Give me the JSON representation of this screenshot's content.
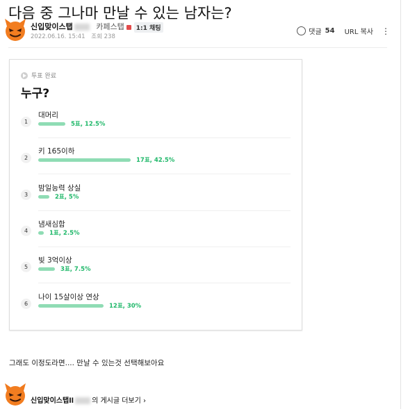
{
  "post": {
    "title": "다음 중 그나마 만날 수 있는 남자는?",
    "author": {
      "nickname": "신입맞이스탭",
      "role": "카페스탭",
      "chat_label": "1:1 채팅"
    },
    "date": "2022.06.16. 15:41",
    "views": "조회 238",
    "comments_label": "댓글",
    "comments_count": "54",
    "url_copy_label": "URL 복사",
    "more_label": "⋮",
    "body_text": "그래도 이정도라면.... 만날 수 있는것 선택해보아요",
    "footer": {
      "nickname": "신입맞이스탭ll",
      "suffix": "의 게시글 더보기 ›"
    }
  },
  "poll": {
    "status": "투표 완료",
    "question": "누구?",
    "bar_color": "#8fdcb4",
    "result_color": "#20b86a",
    "options": [
      {
        "num": "1",
        "label": "대머리",
        "result": "5표, 12.5%",
        "percent": 12.5
      },
      {
        "num": "2",
        "label": "키 165이하",
        "result": "17표, 42.5%",
        "percent": 42.5
      },
      {
        "num": "3",
        "label": "밤일능력 상실",
        "result": "2표, 5%",
        "percent": 5
      },
      {
        "num": "4",
        "label": "냄새심함",
        "result": "1표, 2.5%",
        "percent": 2.5
      },
      {
        "num": "5",
        "label": "빚 3억이상",
        "result": "3표, 7.5%",
        "percent": 7.5
      },
      {
        "num": "6",
        "label": "나이 15살이상 연상",
        "result": "12표, 30%",
        "percent": 30
      }
    ]
  },
  "icons": {
    "avatar": "devil-face-avatar",
    "comments": "comment-bubble-icon",
    "status": "poll-complete-icon"
  }
}
